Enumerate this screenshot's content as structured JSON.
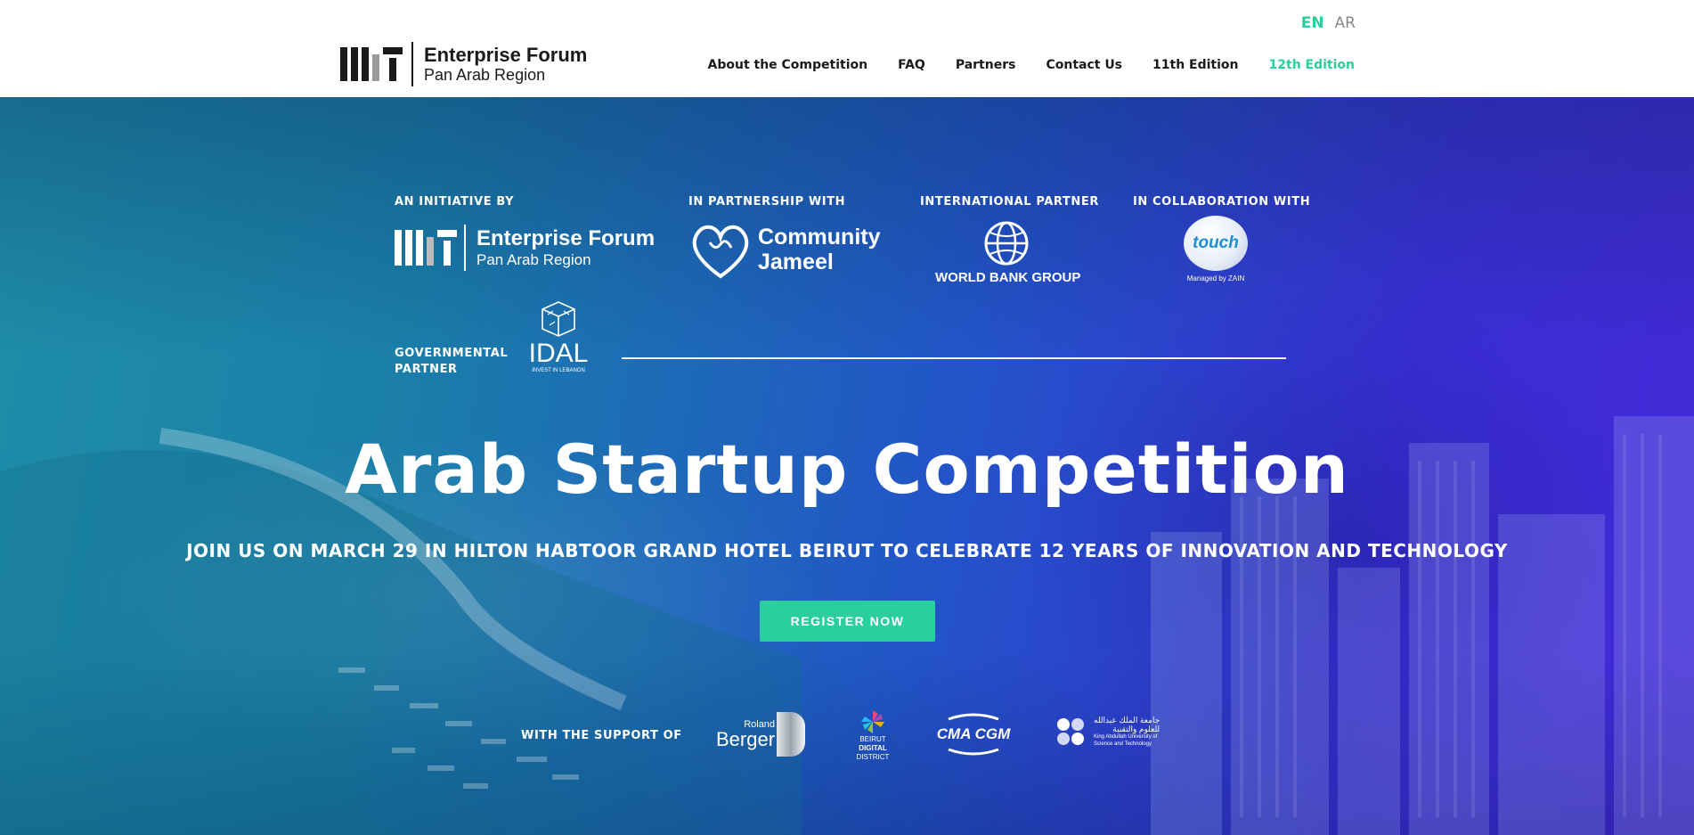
{
  "header": {
    "logo": {
      "main": "Enterprise Forum",
      "sub": "Pan Arab Region"
    },
    "lang": {
      "en": "EN",
      "ar": "AR"
    },
    "nav": [
      {
        "label": "About the Competition"
      },
      {
        "label": "FAQ"
      },
      {
        "label": "Partners"
      },
      {
        "label": "Contact Us"
      },
      {
        "label": "11th Edition"
      },
      {
        "label": "12th Edition"
      }
    ]
  },
  "hero": {
    "labels": {
      "initiative": "AN INITIATIVE BY",
      "partnership": "IN PARTNERSHIP WITH",
      "international": "INTERNATIONAL PARTNER",
      "collaboration": "IN COLLABORATION WITH",
      "governmental_1": "GOVERNMENTAL",
      "governmental_2": "PARTNER",
      "support": "WITH THE SUPPORT OF"
    },
    "partners": {
      "mit_main": "Enterprise Forum",
      "mit_sub": "Pan Arab Region",
      "jameel_1": "Community",
      "jameel_2": "Jameel",
      "worldbank": "WORLD BANK GROUP",
      "touch": "touch",
      "touch_sub": "Managed by ZAIN",
      "idal": "IDAL",
      "idal_sub": "INVEST IN LEBANON"
    },
    "sponsors": {
      "roland_1": "Roland",
      "roland_2": "Berger",
      "bdd_1": "BEIRUT",
      "bdd_2": "DIGITAL",
      "bdd_3": "DISTRICT",
      "cma": "CMA CGM",
      "kaust_ar_1": "جامعة الملك عبدالله",
      "kaust_ar_2": "للعلوم والتقنية",
      "kaust_en_1": "King Abdullah University of",
      "kaust_en_2": "Science and Technology"
    },
    "title": "Arab Startup Competition",
    "subtitle": "JOIN US ON MARCH 29 IN HILTON HABTOOR GRAND HOTEL BEIRUT TO CELEBRATE 12 YEARS OF INNOVATION AND TECHNOLOGY",
    "cta": "REGISTER NOW"
  },
  "colors": {
    "accent": "#2bcf9e",
    "text_dark": "#1a1a1a"
  },
  "icons": [
    "mit-logo-icon",
    "jameel-heart-icon",
    "world-bank-globe-icon",
    "touch-logo-icon",
    "idal-cube-icon",
    "roland-berger-icon",
    "bdd-logo-icon",
    "cma-cgm-icon",
    "kaust-logo-icon"
  ]
}
